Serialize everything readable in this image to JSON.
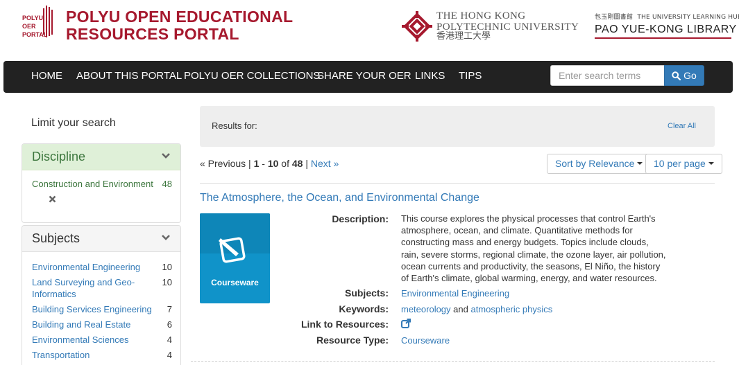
{
  "header": {
    "logo_small": [
      "POLYU",
      "OER",
      "PORTAL"
    ],
    "title_line1": "POLYU OPEN EDUCATIONAL",
    "title_line2": "RESOURCES PORTAL",
    "university_name_line1": "THE HONG KONG",
    "university_name_line2": "POLYTECHNIC UNIVERSITY",
    "university_name_zh": "香港理工大學",
    "library_top_zh": "包玉剛圖書館",
    "library_top_en": "THE UNIVERSITY LEARNING HUB",
    "library_name": "PAO YUE-KONG LIBRARY",
    "brand_color": "#a6192e"
  },
  "nav": {
    "items": [
      "HOME",
      "ABOUT THIS PORTAL",
      "POLYU OER COLLECTIONS",
      "SHARE YOUR OER",
      "LINKS",
      "TIPS"
    ],
    "search_placeholder": "Enter search terms",
    "search_button": "Go"
  },
  "sidebar": {
    "limit_title": "Limit your search",
    "discipline": {
      "title": "Discipline",
      "selected": {
        "label": "Construction and Environment",
        "count": "48"
      }
    },
    "subjects": {
      "title": "Subjects",
      "items": [
        {
          "label": "Environmental Engineering",
          "count": "10"
        },
        {
          "label": "Land Surveying and Geo-Informatics",
          "count": "10"
        },
        {
          "label": "Building Services Engineering",
          "count": "7"
        },
        {
          "label": "Building and Real Estate",
          "count": "6"
        },
        {
          "label": "Environmental Sciences",
          "count": "4"
        },
        {
          "label": "Transportation",
          "count": "4"
        }
      ]
    }
  },
  "results": {
    "results_for": "Results for:",
    "clear_all": "Clear All",
    "pager": {
      "previous": "« Previous",
      "sep": "|",
      "range_start": "1",
      "range_dash": " - ",
      "range_end": "10",
      "of": " of ",
      "total": "48",
      "next": "Next »"
    },
    "sort_label": "Sort by Relevance",
    "per_page_label": "10 per page"
  },
  "record": {
    "title": "The Atmosphere, the Ocean, and Environmental Change",
    "thumb_label": "Courseware",
    "labels": {
      "description": "Description:",
      "subjects": "Subjects:",
      "keywords": "Keywords:",
      "link": "Link to Resources:",
      "type": "Resource Type:"
    },
    "description": "This course explores the physical processes that control Earth's atmosphere, ocean, and climate. Quantitative methods for constructing mass and energy budgets. Topics include clouds, rain, severe storms, regional climate, the ozone layer, air pollution, ocean currents and productivity, the seasons, El Niño, the history of Earth's climate, global warming, energy, and water resources.",
    "subject": "Environmental Engineering",
    "keyword1": "meteorology",
    "keyword_and": " and ",
    "keyword2": "atmospheric physics",
    "resource_type": "Courseware"
  }
}
